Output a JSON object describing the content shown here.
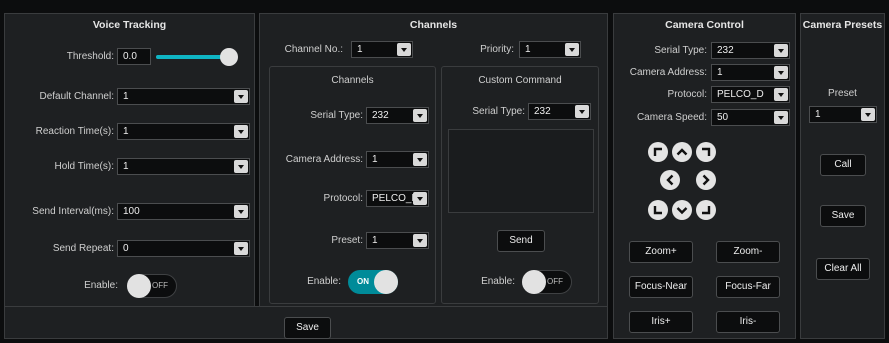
{
  "voice_tracking": {
    "title": "Voice Tracking",
    "threshold_label": "Threshold:",
    "threshold_value": "0.0",
    "threshold_fraction": 0.8,
    "default_channel_label": "Default Channel:",
    "default_channel_value": "1",
    "reaction_time_label": "Reaction Time(s):",
    "reaction_time_value": "1",
    "hold_time_label": "Hold Time(s):",
    "hold_time_value": "1",
    "send_interval_label": "Send Interval(ms):",
    "send_interval_value": "100",
    "send_repeat_label": "Send Repeat:",
    "send_repeat_value": "0",
    "enable_label": "Enable:",
    "enable_state": "OFF"
  },
  "channels": {
    "title": "Channels",
    "channel_no_label": "Channel No.:",
    "channel_no_value": "1",
    "priority_label": "Priority:",
    "priority_value": "1",
    "sub": {
      "title": "Channels",
      "serial_type_label": "Serial Type:",
      "serial_type_value": "232",
      "camera_address_label": "Camera Address:",
      "camera_address_value": "1",
      "protocol_label": "Protocol:",
      "protocol_value": "PELCO_D",
      "preset_label": "Preset:",
      "preset_value": "1",
      "enable_label": "Enable:",
      "enable_state": "ON"
    },
    "custom": {
      "title": "Custom Command",
      "serial_type_label": "Serial Type:",
      "serial_type_value": "232",
      "send_label": "Send",
      "enable_label": "Enable:",
      "enable_state": "OFF"
    },
    "save_label": "Save"
  },
  "camera_control": {
    "title": "Camera Control",
    "serial_type_label": "Serial Type:",
    "serial_type_value": "232",
    "camera_address_label": "Camera Address:",
    "camera_address_value": "1",
    "protocol_label": "Protocol:",
    "protocol_value": "PELCO_D",
    "camera_speed_label": "Camera Speed:",
    "camera_speed_value": "50",
    "zoom_in_label": "Zoom+",
    "zoom_out_label": "Zoom-",
    "focus_near_label": "Focus-Near",
    "focus_far_label": "Focus-Far",
    "iris_plus_label": "Iris+",
    "iris_minus_label": "Iris-"
  },
  "camera_presets": {
    "title": "Camera Presets",
    "preset_label": "Preset",
    "preset_value": "1",
    "call_label": "Call",
    "save_label": "Save",
    "clear_all_label": "Clear All"
  },
  "colors": {
    "accent": "#008b99",
    "panel_bg": "#1e2022",
    "page_bg": "#0c0d0e"
  }
}
